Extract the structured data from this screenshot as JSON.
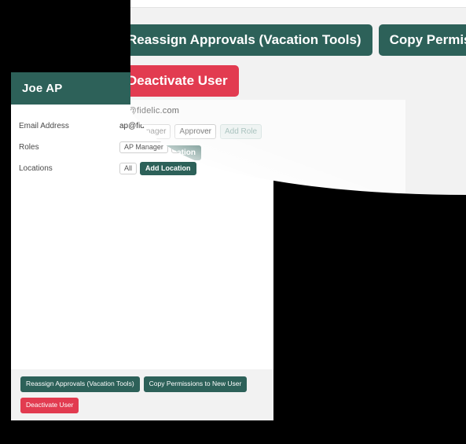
{
  "user": {
    "name": "Joe AP",
    "fields": [
      {
        "label": "Email Address",
        "value": "ap@fidelic.com"
      },
      {
        "label": "Roles",
        "value": ""
      },
      {
        "label": "Locations",
        "value": ""
      }
    ],
    "roles": [
      {
        "label": "AP Manager",
        "state": "assigned"
      },
      {
        "label": "Approver",
        "state": "assigned"
      }
    ],
    "add_role_label": "Add Role",
    "locations": [
      {
        "label": "All"
      }
    ],
    "add_location_label": "Add Location"
  },
  "actions": {
    "reassign_label": "Reassign Approvals (Vacation Tools)",
    "copy_permissions_label": "Copy Permissions to New User",
    "deactivate_label": "Deactivate User"
  },
  "colors": {
    "teal": "#2d6159",
    "red": "#e23b50",
    "page_background": "#000000",
    "panel_background": "#f2f2f2",
    "card_background": "#ffffff"
  }
}
